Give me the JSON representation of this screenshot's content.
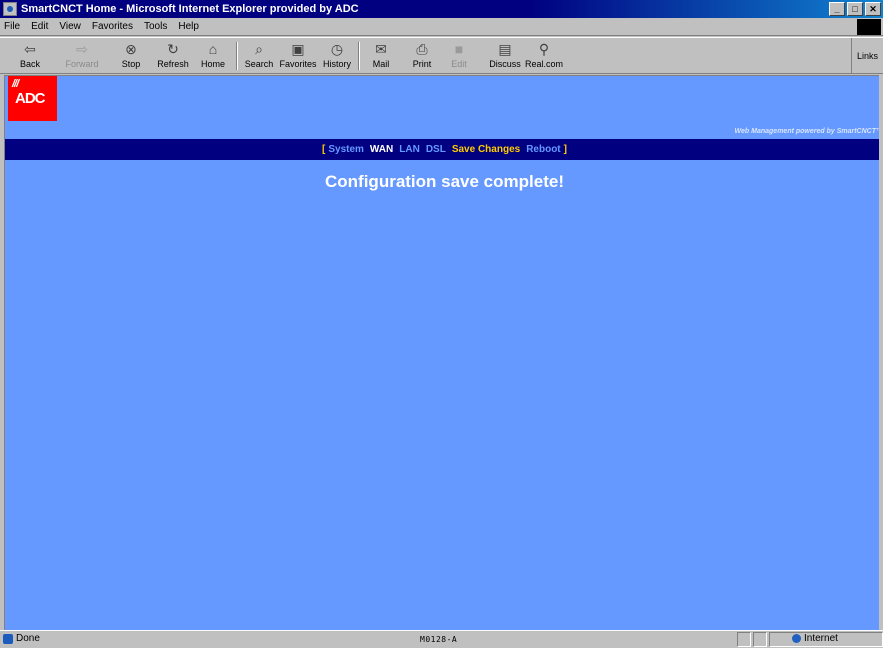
{
  "window": {
    "title": "SmartCNCT Home - Microsoft Internet Explorer provided by ADC",
    "buttons": [
      "_",
      "□",
      "✕"
    ]
  },
  "menubar": {
    "items": [
      "File",
      "Edit",
      "View",
      "Favorites",
      "Tools",
      "Help"
    ]
  },
  "toolbar": {
    "back": "Back",
    "forward": "Forward",
    "stop": "Stop",
    "refresh": "Refresh",
    "home": "Home",
    "search": "Search",
    "favorites": "Favorites",
    "history": "History",
    "mail": "Mail",
    "print": "Print",
    "edit": "Edit",
    "discuss": "Discuss",
    "realcom": "Real.com",
    "links": "Links"
  },
  "page": {
    "logo_text": "ADC",
    "logo_slashes": "///",
    "powered_by": "Web Management powered by SmartCNCT™",
    "nav": {
      "open_bracket": "[",
      "items": [
        "System",
        "WAN",
        "LAN",
        "DSL",
        "Save Changes",
        "Reboot"
      ],
      "close_bracket": "]"
    },
    "message": "Configuration save complete!"
  },
  "statusbar": {
    "status": "Done",
    "model_code": "M0128-A",
    "zone": "Internet"
  },
  "colors": {
    "page_background": "#6699ff",
    "nav_background": "#000080",
    "logo_red": "#ff0000",
    "nav_link": "#6699ff",
    "nav_current": "#ffffff",
    "nav_highlight": "#ffcc00"
  }
}
